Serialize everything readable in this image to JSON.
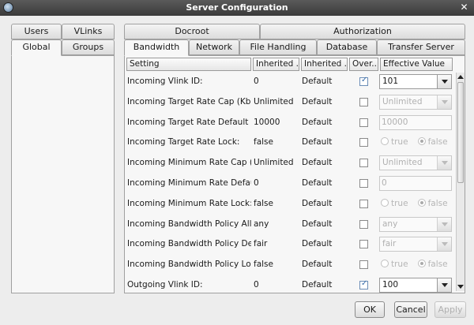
{
  "window": {
    "title": "Server Configuration",
    "close_glyph": "✕"
  },
  "left_tabs": {
    "row1": [
      "Users",
      "VLinks"
    ],
    "row2": [
      "Global",
      "Groups"
    ],
    "active": "Global"
  },
  "right_tabs": {
    "row1": [
      "Docroot",
      "Authorization"
    ],
    "row2": [
      "Bandwidth",
      "Network",
      "File Handling",
      "Database",
      "Transfer Server"
    ],
    "active": "Bandwidth"
  },
  "columns": [
    "Setting",
    "Inherited ...",
    "Inherited ...",
    "Over...",
    "Effective Value"
  ],
  "rows": [
    {
      "setting": "Incoming Vlink ID:",
      "inherited_value": "0",
      "inherited_from": "Default",
      "override": true,
      "control": "combo",
      "value": "101",
      "enabled": true
    },
    {
      "setting": "Incoming Target Rate Cap (Kb...",
      "inherited_value": "Unlimited",
      "inherited_from": "Default",
      "override": false,
      "control": "combo",
      "value": "Unlimited",
      "enabled": false
    },
    {
      "setting": "Incoming Target Rate Default (...",
      "inherited_value": "10000",
      "inherited_from": "Default",
      "override": false,
      "control": "text",
      "value": "10000",
      "enabled": false
    },
    {
      "setting": "Incoming Target Rate Lock:",
      "inherited_value": "false",
      "inherited_from": "Default",
      "override": false,
      "control": "radio",
      "options": [
        "true",
        "false"
      ],
      "value": "false",
      "enabled": false
    },
    {
      "setting": "Incoming Minimum Rate Cap (...",
      "inherited_value": "Unlimited",
      "inherited_from": "Default",
      "override": false,
      "control": "combo",
      "value": "Unlimited",
      "enabled": false
    },
    {
      "setting": "Incoming Minimum Rate Defau...",
      "inherited_value": "0",
      "inherited_from": "Default",
      "override": false,
      "control": "text",
      "value": "0",
      "enabled": false
    },
    {
      "setting": "Incoming Minimum Rate Lock:",
      "inherited_value": "false",
      "inherited_from": "Default",
      "override": false,
      "control": "radio",
      "options": [
        "true",
        "false"
      ],
      "value": "false",
      "enabled": false
    },
    {
      "setting": "Incoming Bandwidth Policy Allo...",
      "inherited_value": "any",
      "inherited_from": "Default",
      "override": false,
      "control": "combo",
      "value": "any",
      "enabled": false
    },
    {
      "setting": "Incoming Bandwidth Policy Def...",
      "inherited_value": "fair",
      "inherited_from": "Default",
      "override": false,
      "control": "combo",
      "value": "fair",
      "enabled": false
    },
    {
      "setting": "Incoming Bandwidth Policy Lock:",
      "inherited_value": "false",
      "inherited_from": "Default",
      "override": false,
      "control": "radio",
      "options": [
        "true",
        "false"
      ],
      "value": "false",
      "enabled": false
    },
    {
      "setting": "Outgoing Vlink ID:",
      "inherited_value": "0",
      "inherited_from": "Default",
      "override": true,
      "control": "combo",
      "value": "100",
      "enabled": true
    }
  ],
  "buttons": {
    "ok": "OK",
    "cancel": "Cancel",
    "apply": "Apply"
  },
  "colors": {
    "titlebar": "#3a3a3a",
    "panel": "#f7f7f7",
    "window": "#ededed",
    "check_accent": "#3b6eaa"
  }
}
